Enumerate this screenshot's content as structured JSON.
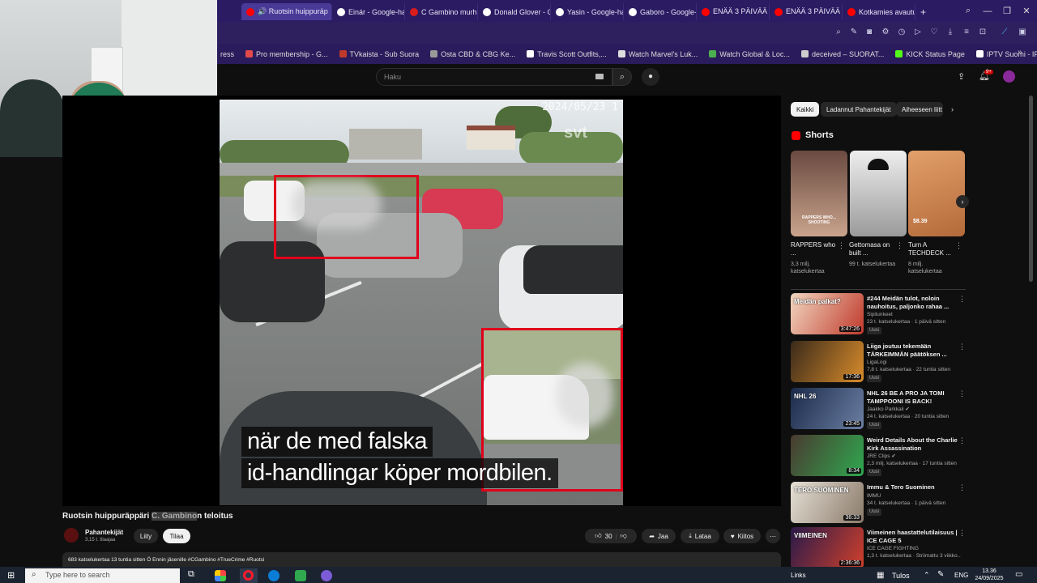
{
  "browser": {
    "tabs": [
      {
        "label": "🔊 Ruotsin huippuräp",
        "color": "#ff0000",
        "active": true
      },
      {
        "label": "Einár - Google-haku",
        "color": "#ffffff"
      },
      {
        "label": "C Gambino murhat",
        "color": "#d91c1c"
      },
      {
        "label": "Donald Glover - Go",
        "color": "#ffffff"
      },
      {
        "label": "Yasin - Google-haku",
        "color": "#ffffff"
      },
      {
        "label": "Gaboro - Google-h",
        "color": "#ffffff"
      },
      {
        "label": "ENÄÄ 3 PÄIVÄÄ🔺",
        "color": "#ff0000"
      },
      {
        "label": "ENÄÄ 3 PÄIVÄÄ🔺",
        "color": "#ff0000"
      },
      {
        "label": "Kotkamies avautuu",
        "color": "#ff0000"
      }
    ],
    "new_tab": "+",
    "bookmarks": [
      {
        "label": "ress",
        "color": "#2b1b63"
      },
      {
        "label": "Pro membership - G...",
        "color": "#e24a4a"
      },
      {
        "label": "TVkaista - Sub Suora",
        "color": "#c0392b"
      },
      {
        "label": "Osta CBD & CBG Ke...",
        "color": "#999999"
      },
      {
        "label": "Travis Scott Outfits,...",
        "color": "#ffffff"
      },
      {
        "label": "Watch Marvel's Luk...",
        "color": "#dddddd"
      },
      {
        "label": "Watch Global & Loc...",
        "color": "#4caf50"
      },
      {
        "label": "deceived – SUORAT...",
        "color": "#cccccc"
      },
      {
        "label": "KICK Status Page",
        "color": "#53fc18"
      },
      {
        "label": "IPTV Suomi - IPTV v...",
        "color": "#ffffff"
      }
    ]
  },
  "youtube": {
    "search_placeholder": "Haku",
    "notification_count": "9+"
  },
  "video": {
    "timestamp_overlay": "2024/05/23 1",
    "watermark": "svt",
    "subtitle_line1": "när de med falska",
    "subtitle_line2": "id-handlingar köper mordbilen.",
    "title_before": "Ruotsin huippuräppäri ",
    "title_highlight": "C. Gambino",
    "title_after": "n teloitus",
    "channel_name": "Pahantekijät",
    "subscribers": "3,15 t. tilaajaa",
    "join_label": "Liity",
    "subscribe_label": "Tilaa",
    "likes": "30",
    "share_label": "Jaa",
    "download_label": "Lataa",
    "thanks_label": "Kiitos",
    "more": "⋯",
    "description_line": "683 katselukertaa  13 tuntia sitten  Ö Ennin jäsenille #CGambino #TrueCrime #Ruotsi"
  },
  "sidebar": {
    "chips": [
      "Kaikki",
      "Ladannut Pahantekijät",
      "Aiheeseen liitt"
    ],
    "shorts_heading": "Shorts",
    "shorts": [
      {
        "title": "RAPPERS who ...",
        "views": "3,3 milj. katselukertaa",
        "overlay": "RAPPERS WHO... SHOOTING"
      },
      {
        "title": "Gettomasa on built ...",
        "views": "99 t. katselukertaa",
        "overlay": ""
      },
      {
        "title": "Turn A TECHDECK ...",
        "views": "8 milj. katselukertaa",
        "overlay": "$8.39"
      }
    ],
    "recommendations": [
      {
        "title": "#244 Meidän tulot, noloin nauhoitus, paljonko rahaa ...",
        "channel": "Sipilunkeet",
        "meta": "23 t. katselukertaa · 1 päivä sitten",
        "duration": "3:47:26",
        "thumb_text": "Meidän palkat?",
        "new": "Uusi"
      },
      {
        "title": "Liiga joutuu tekemään TÄRKEIMMÄN päätöksen ...",
        "channel": "LigaLogi",
        "meta": "7,8 t. katselukertaa · 22 tuntia sitten",
        "duration": "17:36",
        "thumb_text": "",
        "new": "Uusi"
      },
      {
        "title": "NHL 26 BE A PRO JA TOMI TAMPPOONI IS BACK!",
        "channel": "Jaakko Parkkali ✔",
        "meta": "24 t. katselukertaa · 20 tuntia sitten",
        "duration": "23:45",
        "thumb_text": "NHL 26",
        "new": "Uusi"
      },
      {
        "title": "Weird Details About the Charlie Kirk Assassination",
        "channel": "JRE Clips ✔",
        "meta": "2,3 milj. katselukertaa · 17 tuntia sitten",
        "duration": "8:34",
        "thumb_text": "",
        "new": "Uusi"
      },
      {
        "title": "Immu & Tero Suominen",
        "channel": "IMMU",
        "meta": "34 t. katselukertaa · 1 päivä sitten",
        "duration": "36:33",
        "thumb_text": "TERO SUOMINEN",
        "new": "Uusi"
      },
      {
        "title": "Viimeinen haastattelutilaisuus | ICE CAGE 5",
        "channel": "ICE CAGE FIGHTING",
        "meta": "1,3 t. katselukertaa · Striimattu 3 viikko...",
        "duration": "2:36:36",
        "thumb_text": "VIIMEINEN",
        "new": ""
      }
    ]
  },
  "taskbar": {
    "search_placeholder": "Type here to search",
    "links": "Links",
    "print": "Tulos",
    "lang": "ENG",
    "time": "13.36",
    "date": "24/09/2025"
  },
  "colors": {
    "yt_bg": "#0f0f0f",
    "browser_tab_bg": "#2b1b63",
    "red_box": "#e0001b",
    "yt_red": "#ff0000"
  }
}
